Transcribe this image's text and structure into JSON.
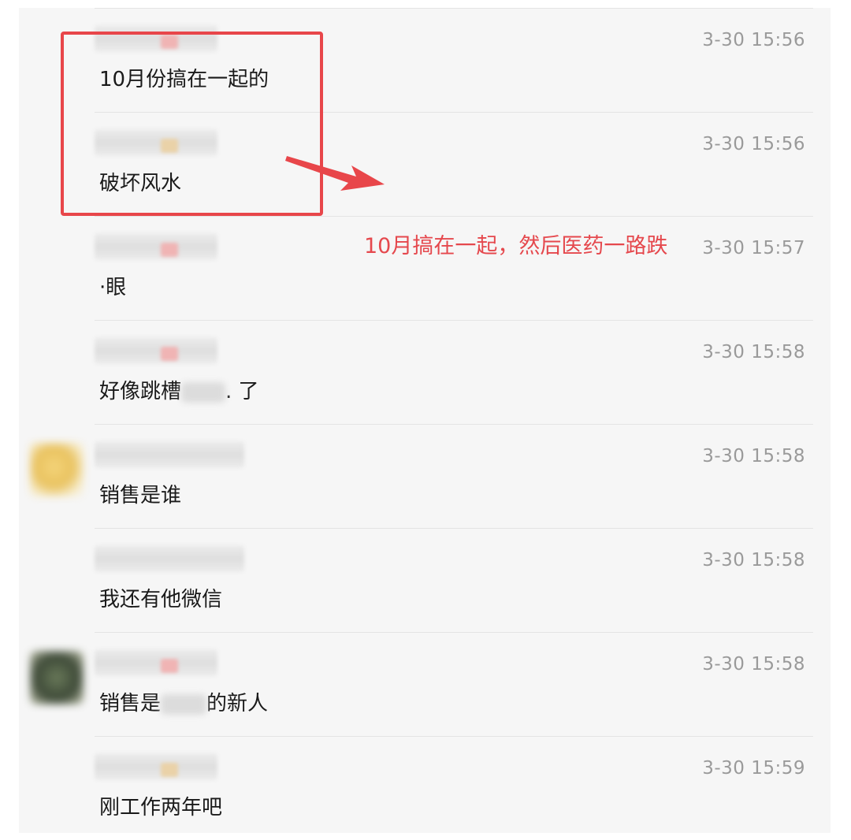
{
  "messages": [
    {
      "time": "3-30 15:56",
      "text": "10月份搞在一起的"
    },
    {
      "time": "3-30 15:56",
      "text": "破坏风水"
    },
    {
      "time": "3-30 15:57",
      "text": "·眼"
    },
    {
      "time": "3-30 15:58",
      "text_before": "好像跳槽",
      "text_after": ". 了"
    },
    {
      "time": "3-30 15:58",
      "text": "销售是谁"
    },
    {
      "time": "3-30 15:58",
      "text": "我还有他微信"
    },
    {
      "time": "3-30 15:58",
      "text_before": "销售是",
      "text_after": "的新人"
    },
    {
      "time": "3-30 15:59",
      "text": "刚工作两年吧"
    }
  ],
  "annotation": {
    "text": "10月搞在一起，然后医药一路跌",
    "color": "#e5484d"
  },
  "colors": {
    "highlight": "#e8464a",
    "time": "#9a9a9a",
    "panel": "#f6f6f6"
  },
  "icons": {
    "annotation_arrow": "arrow-right-icon",
    "avatar_1": "avatar-blurred",
    "avatar_2": "avatar-blurred"
  }
}
